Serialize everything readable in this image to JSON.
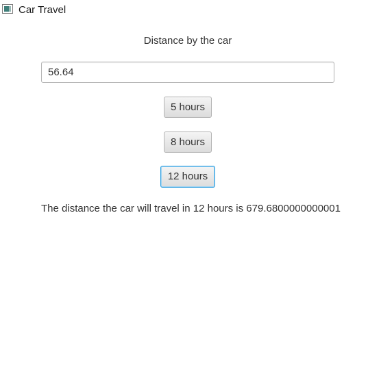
{
  "window": {
    "title": "Car Travel",
    "icon": "app-window-icon"
  },
  "form": {
    "heading": "Distance by the car",
    "distance_value": "56.64",
    "buttons": [
      {
        "label": "5 hours"
      },
      {
        "label": "8 hours"
      },
      {
        "label": "12 hours",
        "focused": true
      }
    ]
  },
  "result": {
    "text": "The distance the car will travel in 12 hours is 679.6800000000001"
  },
  "colors": {
    "background": "#ffffff",
    "text": "#333333",
    "focus_border": "#2d9ee0",
    "button_top": "#f4f4f4",
    "button_bottom": "#dcdcdc"
  }
}
